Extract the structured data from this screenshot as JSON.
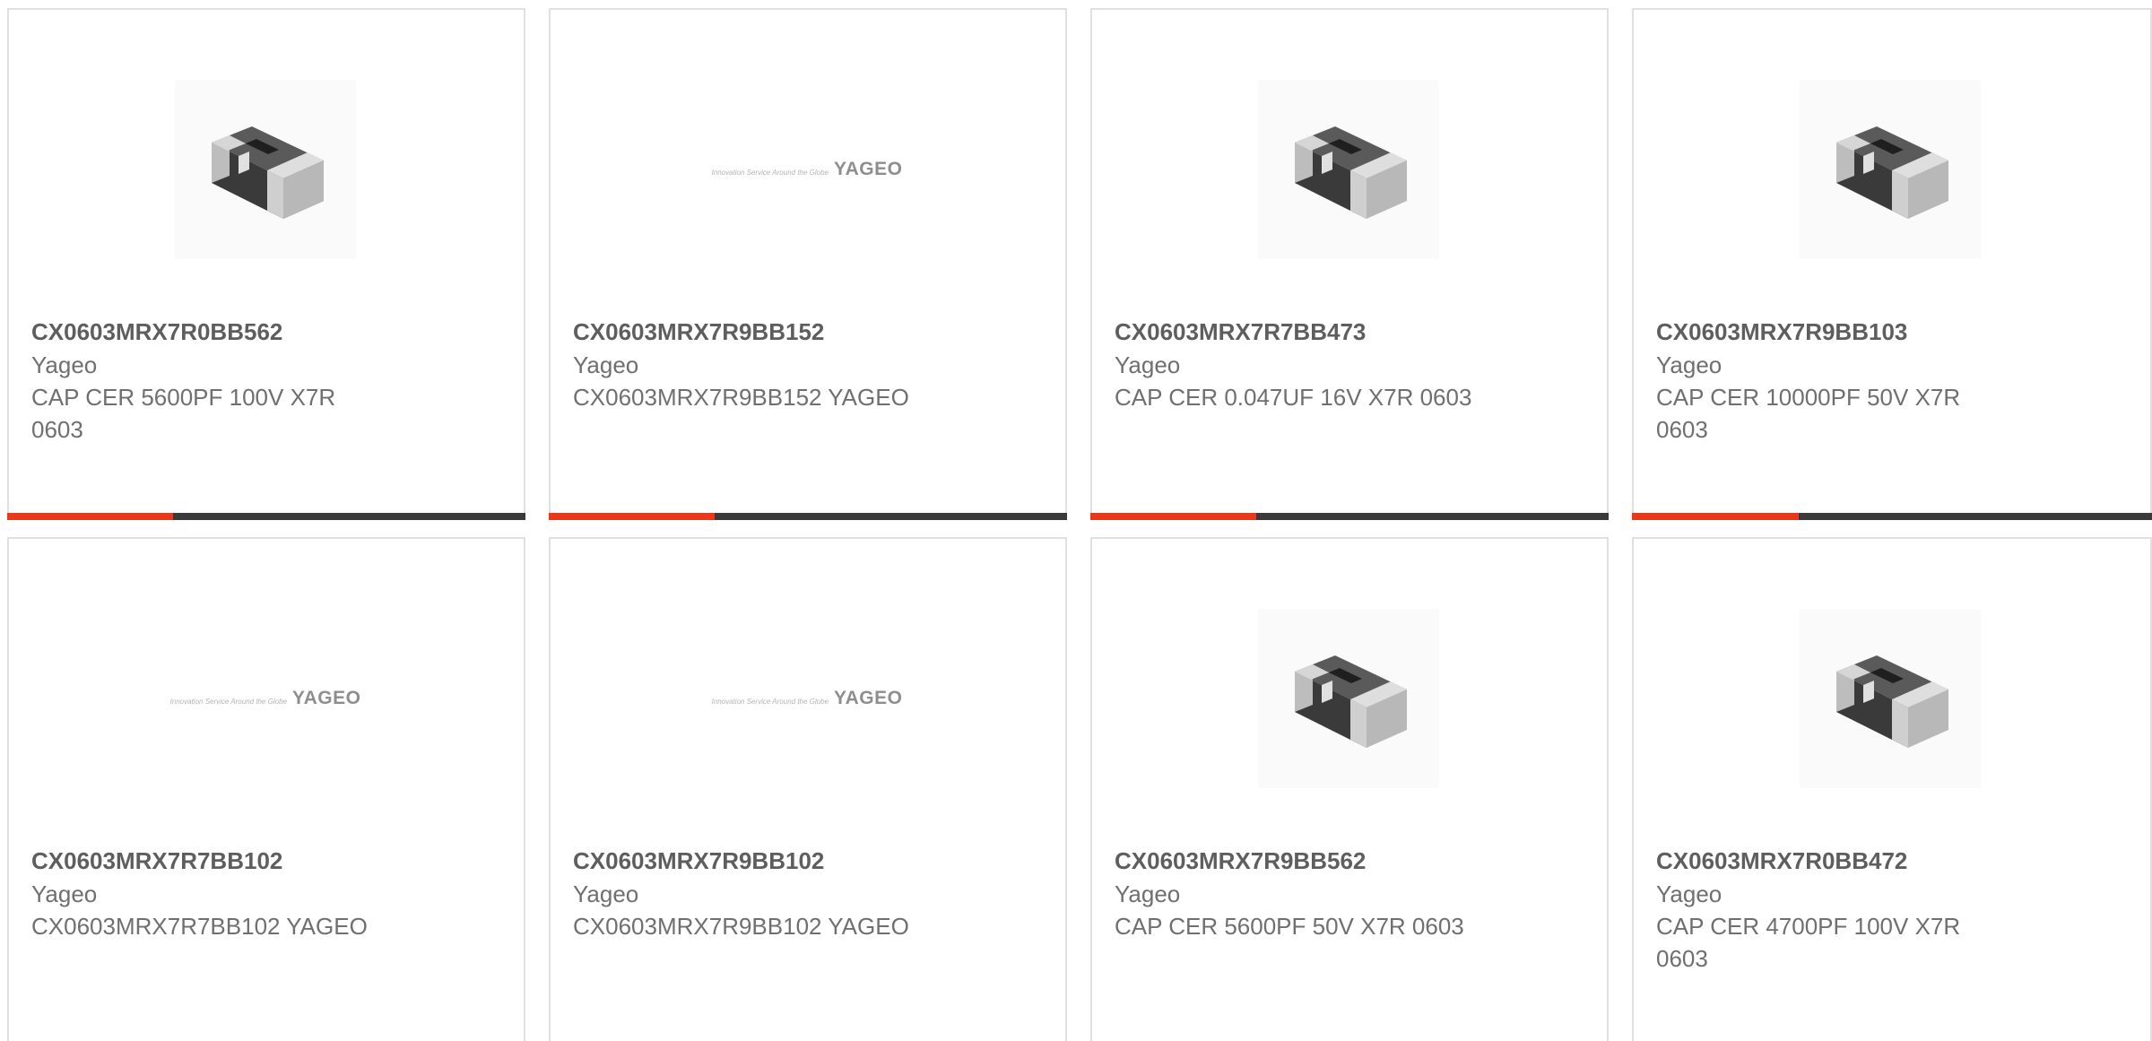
{
  "products": [
    {
      "part_number": "CX0603MRX7R0BB562",
      "manufacturer": "Yageo",
      "description": "CAP CER 5600PF 100V X7R 0603",
      "image": "chip-capacitor",
      "accent_fraction": 0.32
    },
    {
      "part_number": "CX0603MRX7R9BB152",
      "manufacturer": "Yageo",
      "description": "CX0603MRX7R9BB152 YAGEO",
      "image": "yageo-logo",
      "accent_fraction": 0.32
    },
    {
      "part_number": "CX0603MRX7R7BB473",
      "manufacturer": "Yageo",
      "description": "CAP CER 0.047UF 16V X7R 0603",
      "image": "chip-capacitor",
      "accent_fraction": 0.32
    },
    {
      "part_number": "CX0603MRX7R9BB103",
      "manufacturer": "Yageo",
      "description": "CAP CER 10000PF 50V X7R 0603",
      "image": "chip-capacitor",
      "accent_fraction": 0.32
    },
    {
      "part_number": "CX0603MRX7R7BB102",
      "manufacturer": "Yageo",
      "description": "CX0603MRX7R7BB102 YAGEO",
      "image": "yageo-logo"
    },
    {
      "part_number": "CX0603MRX7R9BB102",
      "manufacturer": "Yageo",
      "description": "CX0603MRX7R9BB102 YAGEO",
      "image": "yageo-logo"
    },
    {
      "part_number": "CX0603MRX7R9BB562",
      "manufacturer": "Yageo",
      "description": "CAP CER 5600PF 50V X7R 0603",
      "image": "chip-capacitor"
    },
    {
      "part_number": "CX0603MRX7R0BB472",
      "manufacturer": "Yageo",
      "description": "CAP CER 4700PF 100V X7R 0603",
      "image": "chip-capacitor"
    }
  ],
  "logo": {
    "tagline": "Innovation Service Around the Globe",
    "wordmark": "YAGEO"
  },
  "colors": {
    "accent": "#e8391b",
    "bar": "#3a3a3a",
    "border": "#e0e0e0",
    "text": "#6f6f6f"
  }
}
